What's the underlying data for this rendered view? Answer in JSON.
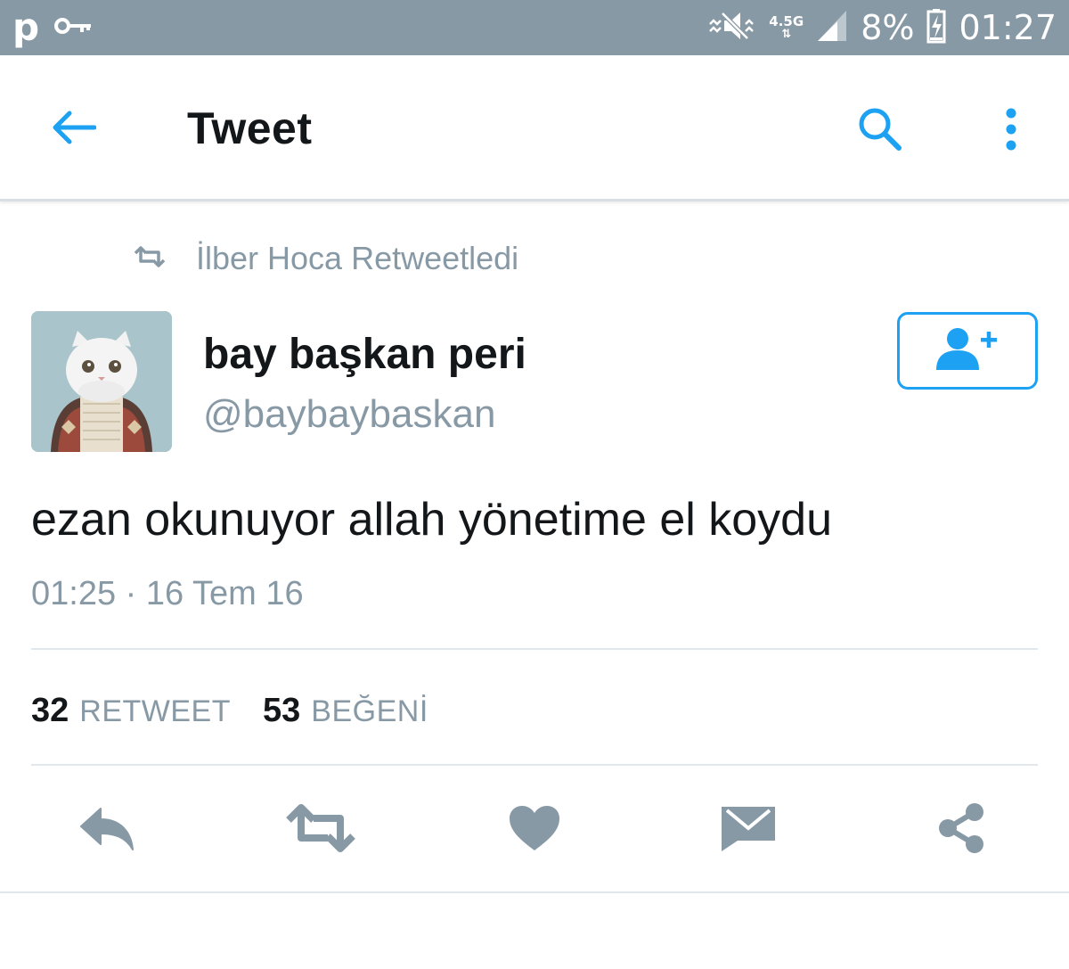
{
  "status_bar": {
    "left_glyph": "p",
    "network_type": "4.5G",
    "battery": "8%",
    "time": "01:27",
    "icons": [
      "notification-p-icon",
      "key-icon",
      "mute-icon",
      "signal-icon",
      "battery-charging-icon"
    ]
  },
  "header": {
    "title": "Tweet",
    "icons": [
      "back-arrow-icon",
      "search-icon",
      "more-vertical-icon"
    ]
  },
  "retweet_context": {
    "text": "İlber Hoca Retweetledi",
    "icon": "retweet-icon"
  },
  "author": {
    "display_name": "bay başkan peri",
    "handle": "@baybaybaskan",
    "follow_icon": "follow-user-plus-icon"
  },
  "tweet": {
    "text": "ezan okunuyor allah yönetime el koydu",
    "timestamp": "01:25 · 16 Tem 16"
  },
  "stats": {
    "retweet_count": "32",
    "retweet_label": "RETWEET",
    "like_count": "53",
    "like_label": "BEĞENİ"
  },
  "actions": [
    "reply-icon",
    "retweet-icon",
    "like-heart-icon",
    "direct-message-icon",
    "share-icon"
  ],
  "colors": {
    "accent": "#1da1f2",
    "muted": "#8899a6",
    "status_bar": "#8899a6",
    "text": "#14171a",
    "divider": "#e1e8ed"
  }
}
